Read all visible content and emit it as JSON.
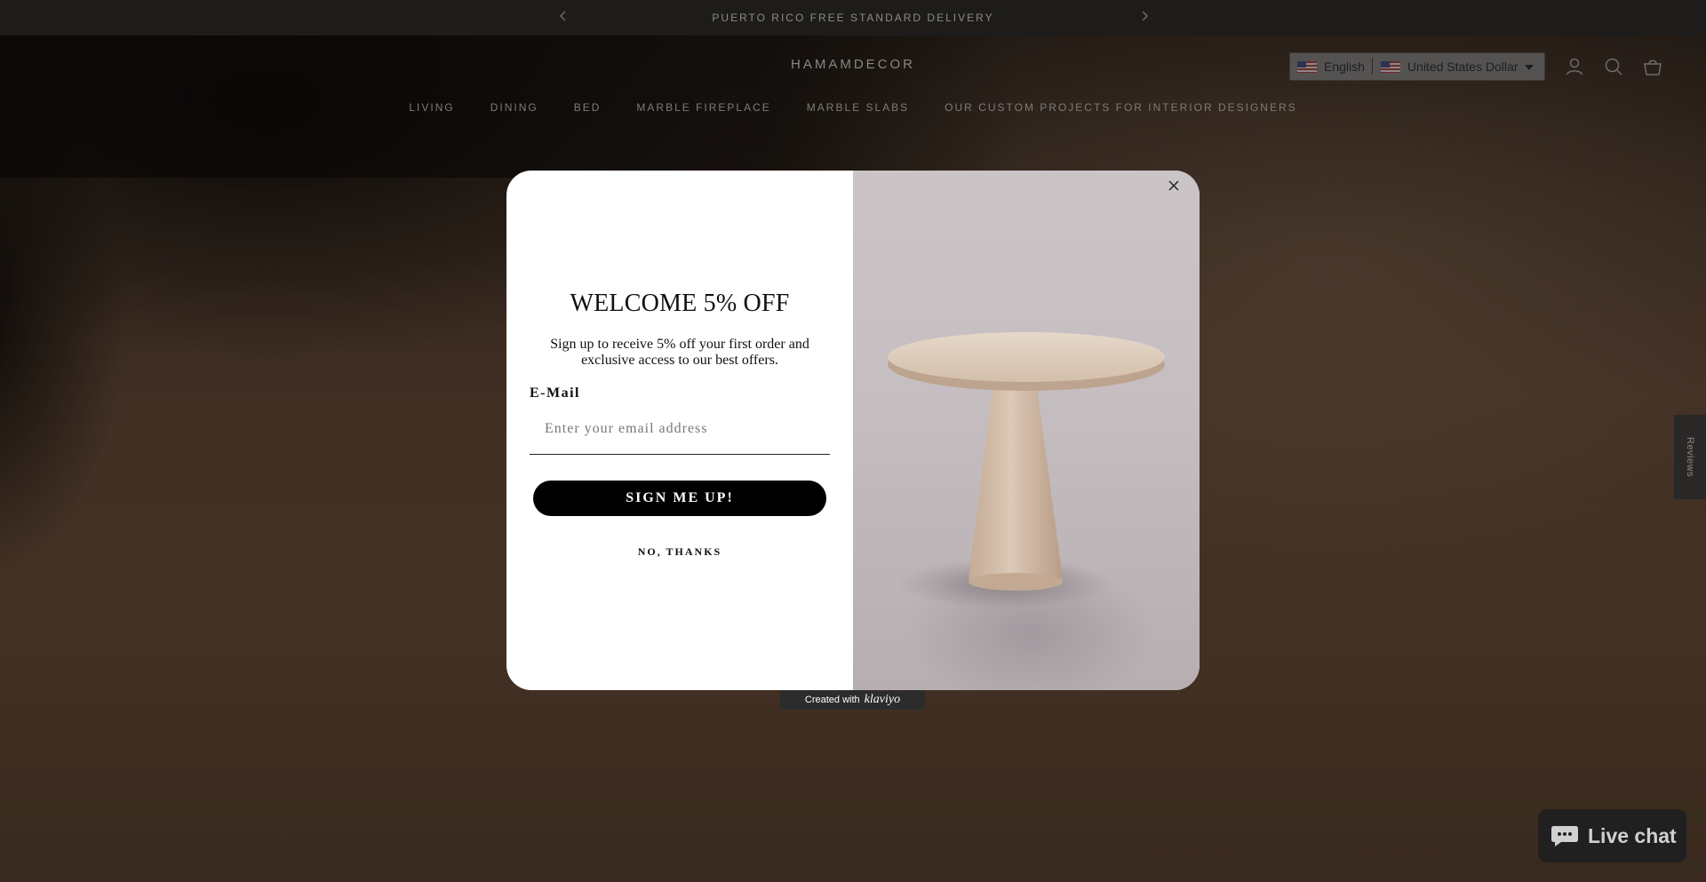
{
  "announcement": {
    "text": "PUERTO RICO FREE STANDARD DELIVERY",
    "prev_icon": "chevron-left",
    "next_icon": "chevron-right"
  },
  "header": {
    "logo": "HAMAMDECOR",
    "language": "English",
    "currency": "United States Dollar",
    "icons": [
      "account-icon",
      "search-icon",
      "cart-icon"
    ]
  },
  "nav": {
    "items": [
      "LIVING",
      "DINING",
      "BED",
      "MARBLE FIREPLACE",
      "MARBLE SLABS",
      "OUR CUSTOM PROJECTS FOR INTERIOR DESIGNERS"
    ]
  },
  "popup": {
    "title": "WELCOME 5% OFF",
    "subtitle": "Sign up to receive 5% off your first order and exclusive access to our best offers.",
    "email_label": "E-Mail",
    "email_placeholder": "Enter your email address",
    "email_value": "",
    "submit_label": "SIGN ME UP!",
    "decline_label": "NO, THANKS",
    "image": "travertine-pedestal-table"
  },
  "klaviyo": {
    "created_with": "Created with",
    "brand": "klaviyo"
  },
  "reviews_tab": {
    "label": "Reviews"
  },
  "live_chat": {
    "label": "Live chat"
  }
}
